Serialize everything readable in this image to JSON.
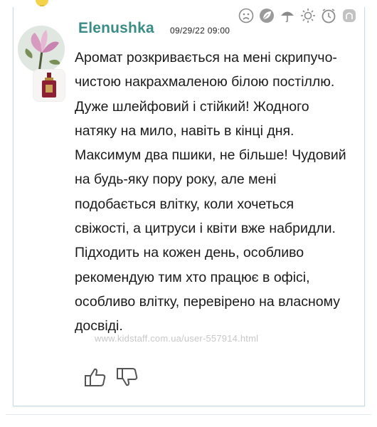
{
  "review": {
    "username": "Elenushka",
    "timestamp": "09/29/22 09:00",
    "text": "Аромат розкривається на мені скрипучо- чистою накрахмаленою білою постіллю. Дуже шлейфовий і стійкий! Жодного натяку на мило, навіть в кінці дня. Максимум два пшики, не більше! Чудовий на будь-яку пору року, але мені подобається влітку, коли хочеться свіжості, а цитруси і квіти вже набридли. Підходить на кожен день, особливо рекомендую тим хто працює в офісі, особливо влітку, перевірено на власному досвіді.",
    "watermark": "www.kidstaff.com.ua/user-557914.html"
  },
  "rating_icons": [
    "sad-face-icon",
    "leaf-icon",
    "umbrella-icon",
    "sun-icon",
    "clock-icon",
    "profile-icon"
  ],
  "colors": {
    "username": "#3a8d86",
    "icon_gray": "#8b8b8b",
    "border": "#c9dde6"
  }
}
